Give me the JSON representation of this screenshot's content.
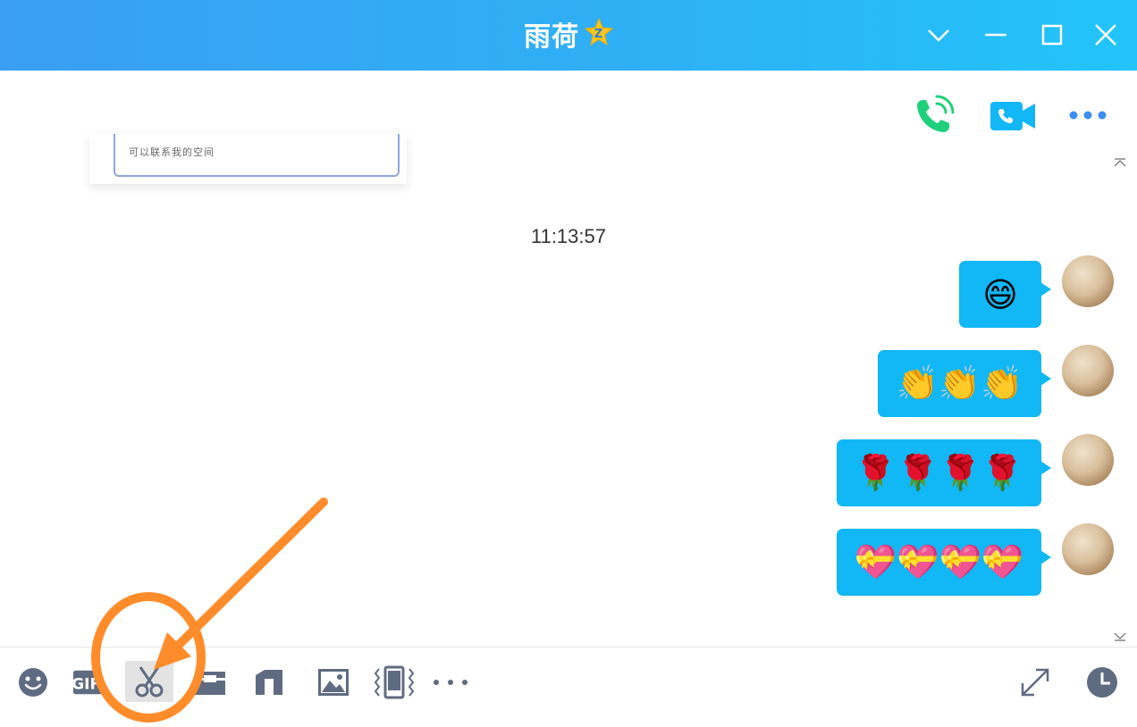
{
  "window": {
    "title": "雨荷",
    "badge_icon": "qq-star-icon",
    "controls": [
      "dropdown-chevron-icon",
      "minimize-icon",
      "maximize-icon",
      "close-icon"
    ]
  },
  "header_actions": [
    "voice-call-icon",
    "video-call-icon",
    "more-dots-icon"
  ],
  "chat": {
    "previous_card_text": "可以联系我的空间",
    "timestamp": "11:13:57",
    "messages": [
      {
        "sender": "me",
        "content": "😄"
      },
      {
        "sender": "me",
        "content": "👏👏👏"
      },
      {
        "sender": "me",
        "content": "🌹🌹🌹🌹"
      },
      {
        "sender": "me",
        "content": "💝💝💝💝"
      }
    ]
  },
  "toolbar": {
    "left": [
      "emoji-icon",
      "gif-icon",
      "screenshot-scissors-icon",
      "file-icon",
      "shortcut-icon",
      "image-icon",
      "shake-icon",
      "more-icon"
    ],
    "right": [
      "expand-icon",
      "history-clock-icon"
    ]
  },
  "colors": {
    "titlebar_start": "#3a9ff2",
    "titlebar_end": "#22c4fb",
    "bubble": "#12b7f5",
    "voice_green": "#1fd07a",
    "video_blue": "#12b7f5",
    "annotation_orange": "#ff8c2a",
    "toolbar_icon": "#5f6b80"
  }
}
